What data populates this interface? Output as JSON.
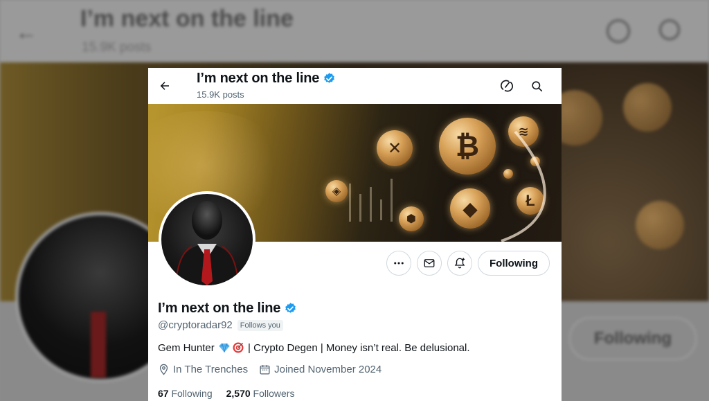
{
  "background_page": {
    "title": "I’m next on the line",
    "posts": "15.9K posts",
    "following_button": "Following"
  },
  "header": {
    "title": "I’m next on the line",
    "posts": "15.9K posts",
    "back_icon": "arrow-left-icon",
    "grok_icon": "grok-icon",
    "search_icon": "search-icon"
  },
  "profile": {
    "name": "I’m next on the line",
    "verified": true,
    "handle": "@cryptoradar92",
    "follows_you": "Follows you",
    "bio_prefix": "Gem Hunter ",
    "bio_emojis": [
      "gem-stone-emoji",
      "direct-hit-emoji"
    ],
    "bio_suffix": " | Crypto Degen | Money isn’t real. Be delusional.",
    "location": "In The Trenches",
    "joined": "Joined November 2024",
    "following_count": "67",
    "following_label": "Following",
    "followers_count": "2,570",
    "followers_label": "Followers"
  },
  "actions": {
    "more_icon": "more-icon",
    "message_icon": "mail-icon",
    "notify_icon": "bell-plus-icon",
    "following_button": "Following"
  },
  "colors": {
    "verified": "#1d9bf0",
    "text_primary": "#0f1419",
    "text_secondary": "#536471",
    "border": "#cfd9de"
  }
}
